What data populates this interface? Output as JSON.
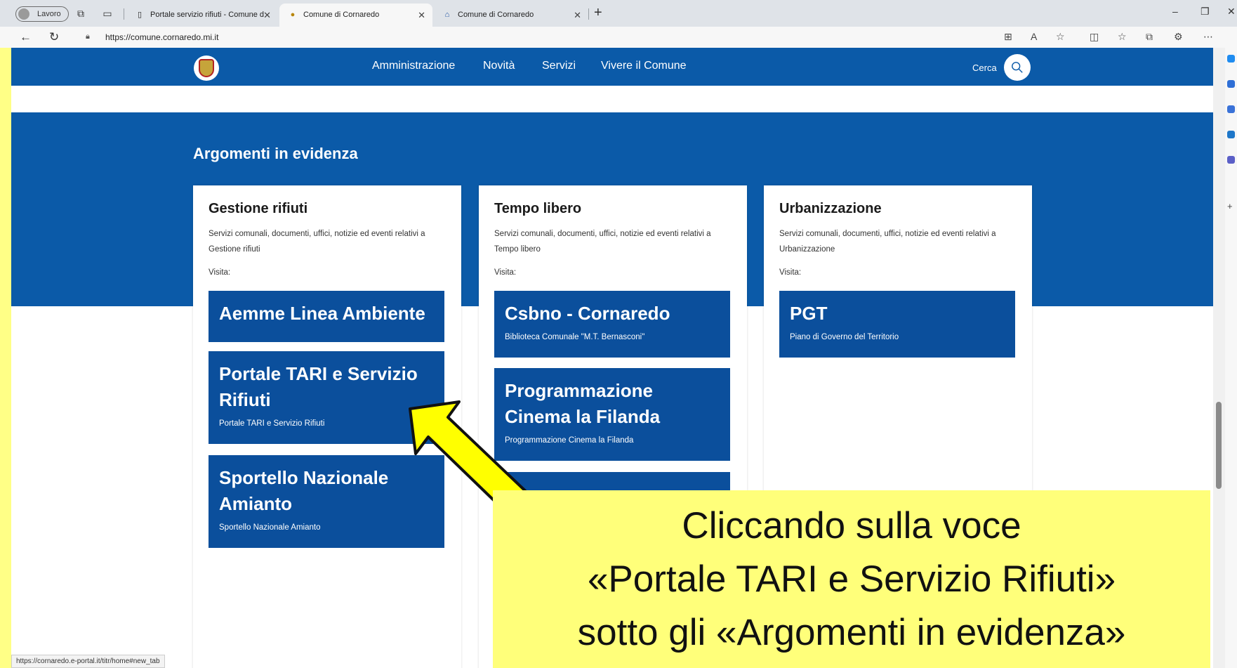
{
  "browser": {
    "profile_label": "Lavoro",
    "tabs": [
      {
        "title": "Portale servizio rifiuti - Comune d",
        "favicon": "page-icon"
      },
      {
        "title": "Comune di Cornaredo",
        "favicon": "crest-icon"
      },
      {
        "title": "Comune di Cornaredo",
        "favicon": "building-icon"
      }
    ],
    "url": "https://comune.cornaredo.mi.it",
    "status_url": "https://cornaredo.e-portal.it/titr/home#new_tab"
  },
  "header": {
    "menu": [
      "Amministrazione",
      "Novità",
      "Servizi",
      "Vivere il Comune"
    ],
    "search_label": "Cerca"
  },
  "evidence": {
    "title": "Argomenti in evidenza",
    "cards": [
      {
        "title": "Gestione rifiuti",
        "desc": "Servizi comunali, documenti, uffici, notizie ed eventi relativi a Gestione rifiuti",
        "visit": "Visita:",
        "links": [
          {
            "title": "Aemme Linea Ambiente",
            "subtitle": ""
          },
          {
            "title": "Portale TARI e Servizio Rifiuti",
            "subtitle": "Portale TARI e Servizio Rifiuti"
          },
          {
            "title": "Sportello Nazionale Amianto",
            "subtitle": "Sportello Nazionale Amianto"
          }
        ]
      },
      {
        "title": "Tempo libero",
        "desc": "Servizi comunali, documenti, uffici, notizie ed eventi relativi a Tempo libero",
        "visit": "Visita:",
        "links": [
          {
            "title": "Csbno - Cornaredo",
            "subtitle": "Biblioteca Comunale \"M.T. Bernasconi\""
          },
          {
            "title": "Programmazione Cinema la Filanda",
            "subtitle": "Programmazione Cinema la Filanda"
          }
        ]
      },
      {
        "title": "Urbanizzazione",
        "desc": "Servizi comunali, documenti, uffici, notizie ed eventi relativi a Urbanizzazione",
        "visit": "Visita:",
        "links": [
          {
            "title": "PGT",
            "subtitle": "Piano di Governo del Territorio"
          }
        ]
      }
    ]
  },
  "callout": {
    "lines": [
      "Cliccando sulla voce",
      "«Portale TARI e Servizio Rifiuti»",
      "sotto gli «Argomenti in evidenza»"
    ],
    "color": "#ffff7a"
  },
  "colors": {
    "brand": "#0b5aa8",
    "link_box": "#0b4f9c",
    "arrow": "#ffff00"
  }
}
